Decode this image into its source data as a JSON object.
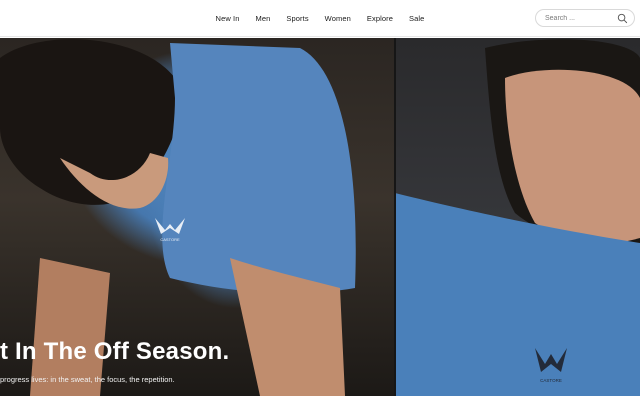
{
  "nav": {
    "links": [
      "New In",
      "Men",
      "Sports",
      "Women",
      "Explore",
      "Sale"
    ]
  },
  "search": {
    "placeholder": "Search ...",
    "icon": "search-icon"
  },
  "hero": {
    "headline": "t In The Off Season.",
    "subtext": "progress lives: in the sweat, the focus, the repetition.",
    "logo_text": "CASTORE",
    "colors": {
      "shirt_blue": "#4a7fb8",
      "overlay_text": "#ffffff"
    }
  }
}
